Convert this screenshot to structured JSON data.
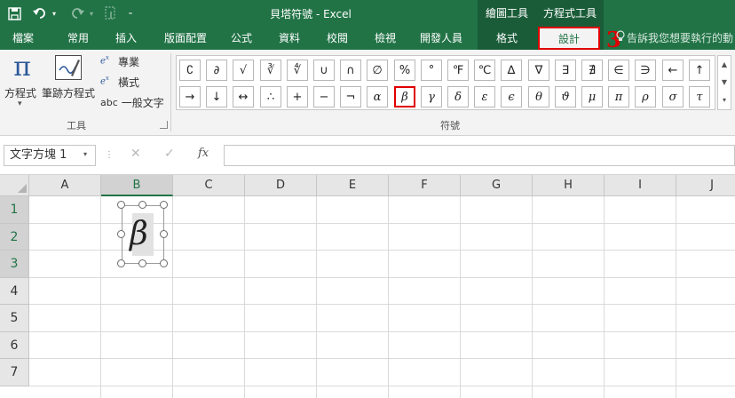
{
  "title_bar": {
    "document_title": "貝塔符號 - Excel",
    "ctx_drawing_title": "繪圖工具",
    "ctx_equation_title": "方程式工具",
    "quick_access_icons": [
      "save-icon",
      "undo-icon",
      "undo-dropdown-icon",
      "redo-icon",
      "redo-dropdown-icon",
      "touch-mode-icon",
      "customize-toolbar-icon"
    ],
    "accent_color": "#217346"
  },
  "tabs": [
    {
      "label": "檔案"
    },
    {
      "label": "常用"
    },
    {
      "label": "插入"
    },
    {
      "label": "版面配置"
    },
    {
      "label": "公式"
    },
    {
      "label": "資料"
    },
    {
      "label": "校閱"
    },
    {
      "label": "檢視"
    },
    {
      "label": "開發人員"
    },
    {
      "label": "格式"
    },
    {
      "label": "設計"
    }
  ],
  "tell_me": "告訴我您想要執行的動",
  "step_number": "3",
  "ribbon": {
    "tools_group": {
      "label": "工具",
      "equation": {
        "label": "方程式"
      },
      "ink_equation": {
        "label": "筆跡方程式"
      },
      "professional": {
        "label": "專業"
      },
      "linear": {
        "label": "橫式"
      },
      "normal_text": {
        "icon_text": "abc",
        "label": "一般文字"
      }
    },
    "symbols_group": {
      "label": "符號",
      "row1": [
        "∁",
        "∂",
        "√",
        "∛",
        "∜",
        "∪",
        "∩",
        "∅",
        "%",
        "°",
        "℉",
        "℃",
        "∆",
        "∇",
        "∃",
        "∄",
        "∈",
        "∋",
        "←",
        "↑"
      ],
      "row2": [
        "→",
        "↓",
        "↔",
        "∴",
        "+",
        "−",
        "¬",
        "α",
        "β",
        "γ",
        "δ",
        "ε",
        "ϵ",
        "θ",
        "ϑ",
        "μ",
        "π",
        "ρ",
        "σ",
        "τ"
      ],
      "selected_symbol": "β"
    }
  },
  "formula_bar": {
    "name_box": "文字方塊 1",
    "fx": "fx",
    "value": ""
  },
  "grid": {
    "columns": [
      "A",
      "B",
      "C",
      "D",
      "E",
      "F",
      "G",
      "H",
      "I",
      "J"
    ],
    "rows": [
      "1",
      "2",
      "3",
      "4",
      "5",
      "6",
      "7"
    ],
    "selected_column": "B",
    "selected_rows": [
      "1",
      "2",
      "3"
    ]
  },
  "equation_box": {
    "content": "β"
  }
}
